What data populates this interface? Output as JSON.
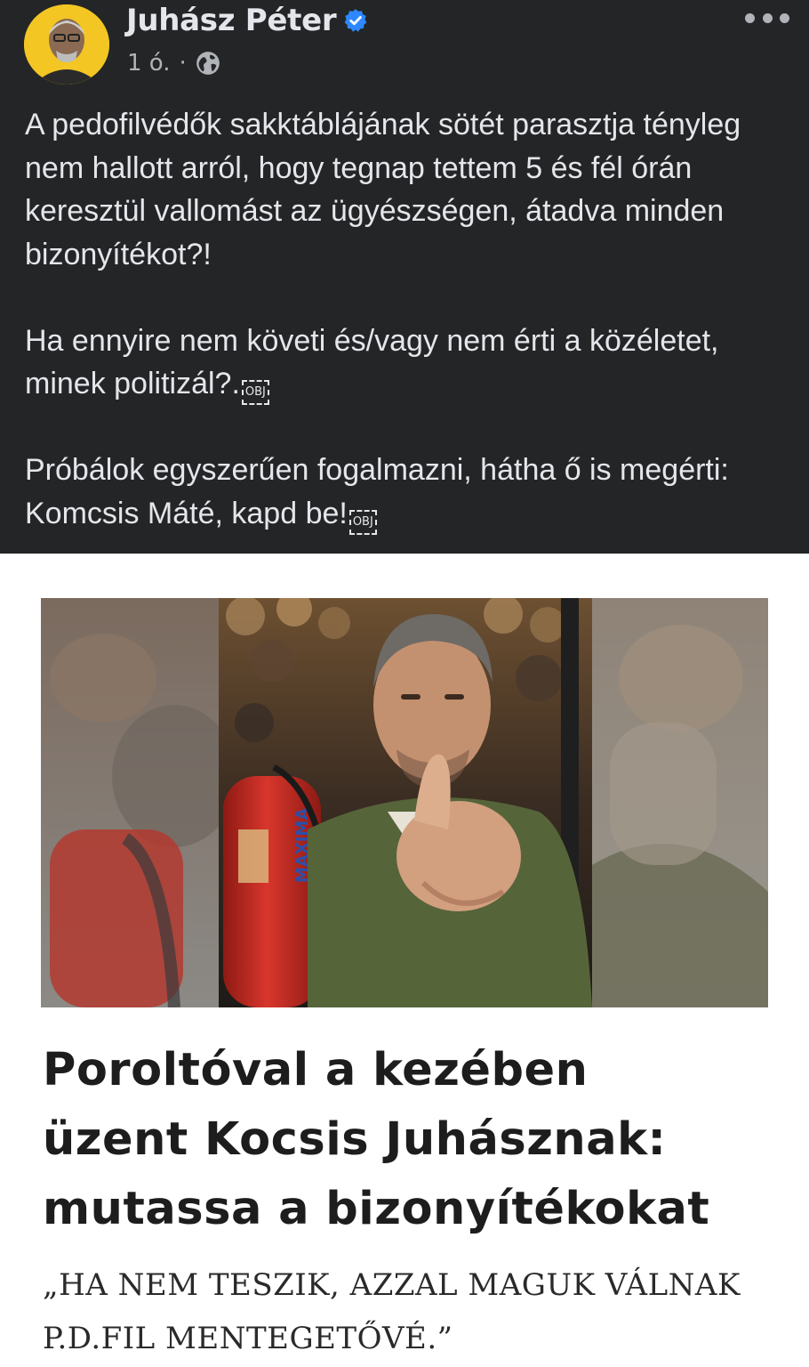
{
  "post": {
    "author_name": "Juhász Péter",
    "verified_icon": "verified-badge-icon",
    "timestamp": "1 ó.",
    "separator": "·",
    "privacy_icon": "globe-icon",
    "more_icon": "more-options-icon",
    "paragraphs": [
      "A pedofilvédők sakktáblájának sötét parasztja tényleg nem hallott arról, hogy tegnap tettem 5 és fél órán keresztül vallomást az ügyészségen, átadva minden bizonyítékot?!",
      "Ha ennyire nem követi és/vagy nem érti a közéletet, minek politizál?.",
      "Próbálok egyszerűen fogalmazni, hátha ő is megérti: Komcsis Máté, kapd be!"
    ],
    "obj_placeholder": "OBJ"
  },
  "article": {
    "headline_lines": [
      "Poroltóval a kezében",
      "üzent Kocsis Juhásznak:",
      "mutassa a bizonyítékokat"
    ],
    "quote_lines": [
      "„HA NEM TESZIK, AZZAL MAGUK VÁLNAK",
      "P.D.FIL MENTEGETŐVÉ.”"
    ],
    "extinguisher_label": "MAXIMA"
  },
  "colors": {
    "post_background": "#242526",
    "post_text": "#e4e6eb",
    "secondary_text": "#b0b3b8",
    "verified_blue": "#2d88ff",
    "avatar_yellow": "#f3c623",
    "extinguisher_red": "#c8261f",
    "shirt_green": "#5b6a3a"
  }
}
